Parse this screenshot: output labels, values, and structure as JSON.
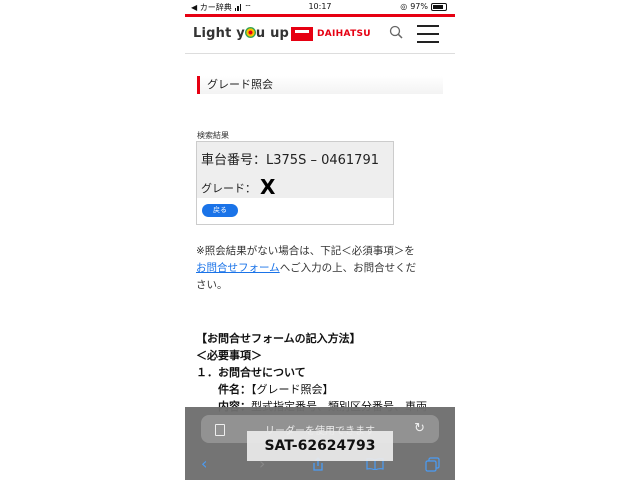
{
  "status_bar": {
    "carrier": "◀ カー辞典",
    "time": "10:17",
    "battery": "97%"
  },
  "header": {
    "logo_text_1": "Light y",
    "logo_text_2": "u up",
    "brand": "DAIHATSU",
    "icons": [
      "search-icon",
      "menu-icon"
    ]
  },
  "section": {
    "title": "グレード照会"
  },
  "result": {
    "label": "検索結果",
    "chassis_label": "車台番号：",
    "chassis_value": "L375S – 0461791",
    "grade_label": "グレード：",
    "grade_value": "X",
    "back_button": "戻る"
  },
  "notice": {
    "line1": "※照会結果がない場合は、下記＜必須事項＞を",
    "link": "お問合せフォーム",
    "line2": "へご入力の上、お問合せくだ",
    "line3": "さい。"
  },
  "inquiry": {
    "heading": "【お問合せフォームの記入方法】",
    "required": "＜必要事項＞",
    "item1": "１．お問合せについて",
    "subject_label": "件名：",
    "subject_value": "【グレード照会】",
    "content_label": "内容：",
    "content_value": "型式指定番号、類別区分番号、車両"
  },
  "safari": {
    "reader_text": "リーダーを使用できます",
    "accent": "#4a9cf5"
  },
  "watermark": "SAT-62624793",
  "colors": {
    "brand_red": "#e60012",
    "link_blue": "#1a73e8"
  }
}
